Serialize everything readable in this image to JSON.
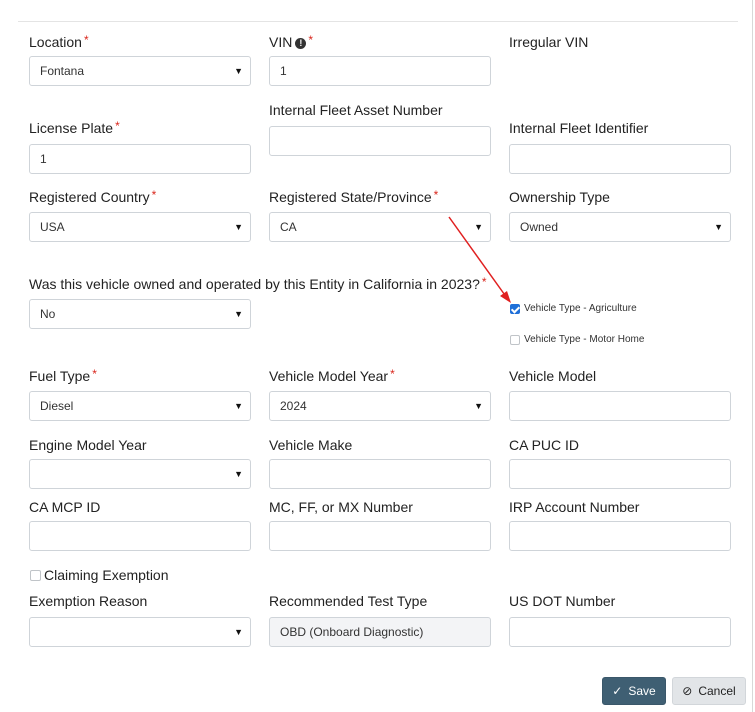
{
  "fields": {
    "location": {
      "label": "Location",
      "value": "Fontana"
    },
    "vin": {
      "label": "VIN",
      "value": "1"
    },
    "irregular_vin": {
      "label": "Irregular VIN"
    },
    "license_plate": {
      "label": "License Plate",
      "value": "1"
    },
    "internal_fleet_asset_number": {
      "label": "Internal Fleet Asset Number",
      "value": ""
    },
    "internal_fleet_identifier": {
      "label": "Internal Fleet Identifier",
      "value": ""
    },
    "registered_country": {
      "label": "Registered Country",
      "value": "USA"
    },
    "registered_state": {
      "label": "Registered State/Province",
      "value": "CA"
    },
    "ownership_type": {
      "label": "Ownership Type",
      "value": "Owned"
    },
    "owned_in_california": {
      "label": "Was this vehicle owned and operated by this Entity in California in 2023?",
      "value": "No"
    },
    "fuel_type": {
      "label": "Fuel Type",
      "value": "Diesel"
    },
    "vehicle_model_year": {
      "label": "Vehicle Model Year",
      "value": "2024"
    },
    "vehicle_model": {
      "label": "Vehicle Model",
      "value": ""
    },
    "engine_model_year": {
      "label": "Engine Model Year",
      "value": ""
    },
    "vehicle_make": {
      "label": "Vehicle Make",
      "value": ""
    },
    "ca_puc_id": {
      "label": "CA PUC ID",
      "value": ""
    },
    "ca_mcp_id": {
      "label": "CA MCP ID",
      "value": ""
    },
    "mc_ff_mx_number": {
      "label": "MC, FF, or MX Number",
      "value": ""
    },
    "irp_account_number": {
      "label": "IRP Account Number",
      "value": ""
    },
    "exemption_reason": {
      "label": "Exemption Reason",
      "value": ""
    },
    "recommended_test_type": {
      "label": "Recommended Test Type",
      "value": "OBD (Onboard Diagnostic)"
    },
    "us_dot_number": {
      "label": "US DOT Number",
      "value": ""
    }
  },
  "required_marker": "*",
  "checkboxes": {
    "vehicle_type_agriculture": {
      "label": "Vehicle Type - Agriculture",
      "checked": true
    },
    "vehicle_type_motor_home": {
      "label": "Vehicle Type - Motor Home",
      "checked": false
    },
    "claiming_exemption": {
      "label": "Claiming Exemption",
      "checked": false
    }
  },
  "buttons": {
    "save": "Save",
    "cancel": "Cancel"
  },
  "icons": {
    "caret": "caret-down-icon",
    "info": "info-icon",
    "save": "check-icon",
    "cancel": "ban-icon"
  },
  "colors": {
    "required": "#d9261c",
    "save_button": "#3f5f73",
    "checkbox_checked": "#1f6fd8",
    "annotation_arrow": "#e02020"
  }
}
